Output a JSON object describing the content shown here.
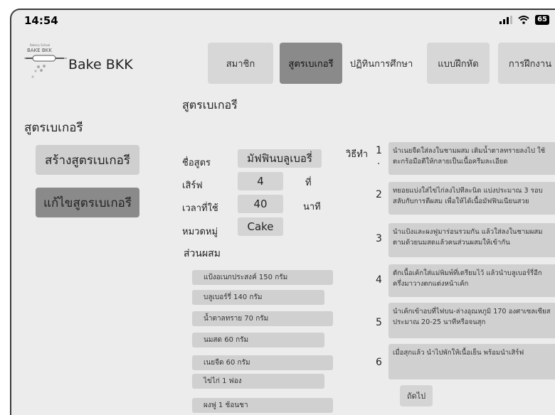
{
  "status": {
    "time": "14:54",
    "battery": "65"
  },
  "brand": {
    "name": "Bake BKK",
    "logo_text": "Bakery School BAKE BKK"
  },
  "nav": {
    "tabs": [
      {
        "label": "สมาชิก"
      },
      {
        "label": "สูตรเบเกอรี"
      },
      {
        "label": "ปฏิทินการศึกษา"
      },
      {
        "label": "แบบฝึกหัด"
      },
      {
        "label": "การฝึกงาน"
      }
    ],
    "active_index": 1
  },
  "page_title": "สูตรเบเกอรี",
  "sidebar": {
    "title": "สูตรเบเกอรี",
    "create_label": "สร้างสูตรเบเกอรี",
    "edit_label": "แก้ไขสูตรเบเกอรี"
  },
  "recipe": {
    "name_label": "ชื่อสูตร",
    "name": "มัฟฟินบลูเบอรี่",
    "serve_label": "เสิร์ฟ",
    "serve_value": "4",
    "serve_unit": "ที่",
    "time_label": "เวลาที่ใช้",
    "time_value": "40",
    "time_unit": "นาที",
    "category_label": "หมวดหมู่",
    "category": "Cake",
    "ingredients_label": "ส่วนผสม",
    "ingredients": [
      "แป้งอเนกประสงค์ 150 กรัม",
      "บลูเบอร์รี่ 140 กรัม",
      "น้ำตาลทราย 70 กรัม",
      "นมสด 60 กรัม",
      "เนยจืด 60 กรัม",
      "ไข่ไก่ 1 ฟอง",
      "ผงฟู 1 ช้อนชา"
    ],
    "method_label": "วิธีทำ",
    "steps": [
      {
        "num": "1",
        "text": "นำเนยจืดใส่ลงในชามผสม เติมน้ำตาลทรายลงไป ใช้ตะกร้อมือตีให้กลายเป็นเนื้อครีมละเอียด"
      },
      {
        "num": "2",
        "text": "ทยอยแบ่งใส่ไข่ไก่ลงไปทีละนิด แบ่งประมาณ 3 รอบ สลับกับการตีผสม เพื่อให้ได้เนื้อมัฟฟินเนียนสวย"
      },
      {
        "num": "3",
        "text": "นำแป้งและผงฟูมาร่อนรวมกัน แล้วใส่ลงในชามผสม ตามด้วยนมสดแล้วคนส่วนผสมให้เข้ากัน"
      },
      {
        "num": "4",
        "text": "ตักเนื้อเค้กใส่แม่พิมพ์ที่เตรียมไว้ แล้วนำบลูเบอร์รี่อีกครึ่งมาวางตกแต่งหน้าเค้ก"
      },
      {
        "num": "5",
        "text": "นำเค้กเข้าอบที่ไฟบน-ล่างอุณหภูมิ 170 องศาเซลเซียสประมาณ 20-25 นาทีหรือจนสุก"
      },
      {
        "num": "6",
        "text": "เมื่อสุกแล้ว นำไปพักให้เนื้อเย็น พร้อมนำเสิร์ฟ"
      }
    ],
    "next_label": "ถัดไป"
  }
}
